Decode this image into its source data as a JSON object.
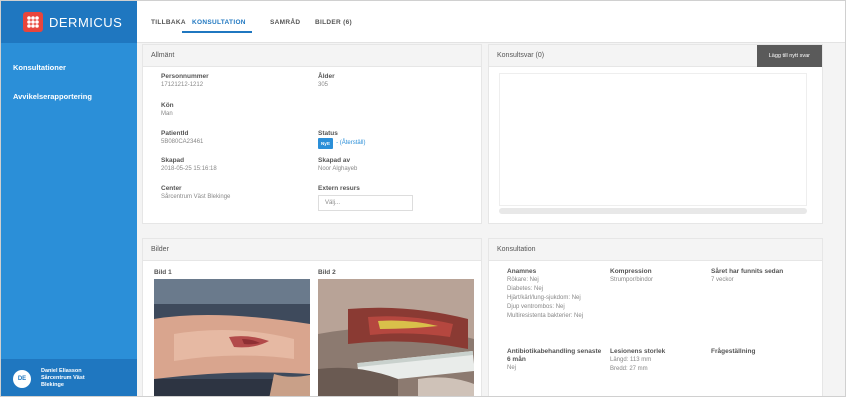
{
  "brand": {
    "name": "DERMICUS"
  },
  "sidebar": {
    "items": [
      {
        "label": "Konsultationer"
      },
      {
        "label": "Avvikelserapportering"
      }
    ]
  },
  "user": {
    "initials": "DE",
    "name": "Daniel Eliasson",
    "org_line1": "Sårcentrum Väst",
    "org_line2": "Blekinge"
  },
  "tabs": [
    {
      "label": "TILLBAKA"
    },
    {
      "label": "KONSULTATION",
      "active": true
    },
    {
      "label": "SAMRÅD"
    },
    {
      "label": "BILDER (6)"
    }
  ],
  "general": {
    "title": "Allmänt",
    "personnummer_label": "Personnummer",
    "personnummer": "17121212-1212",
    "alder_label": "Ålder",
    "alder": "305",
    "kon_label": "Kön",
    "kon": "Man",
    "patientid_label": "PatientId",
    "patientid": "5B080CA23461",
    "status_label": "Status",
    "status_badge": "Nytt",
    "status_link": "(Återställ)",
    "skapad_label": "Skapad",
    "skapad": "2018-05-25 15:16:18",
    "skapad_av_label": "Skapad av",
    "skapad_av": "Noor Alghayeb",
    "center_label": "Center",
    "center": "Sårcentrum Väst Blekinge",
    "extern_label": "Extern resurs",
    "extern_placeholder": "Välj..."
  },
  "answers": {
    "title": "Konsultsvar (0)",
    "add_button": "Lägg till nytt svar"
  },
  "images": {
    "title": "Bilder",
    "bild1": "Bild 1",
    "bild2": "Bild 2"
  },
  "consultation": {
    "title": "Konsultation",
    "anamnes_label": "Anamnes",
    "anamnes_lines": [
      "Rökare: Nej",
      "Diabetes: Nej",
      "Hjärt/kärl/lung-sjukdom: Nej",
      "Djup ventrombos: Nej",
      "Multiresistenta bakterier: Nej"
    ],
    "kompression_label": "Kompression",
    "kompression": "Strumpor/bindor",
    "saret_label": "Såret har funnits sedan",
    "saret": "7 veckor",
    "antibiotika_label_1": "Antibiotikabehandling senaste",
    "antibiotika_label_2": "6 mån",
    "antibiotika": "Nej",
    "lesion_label": "Lesionens storlek",
    "lesion_length": "Längd: 113 mm",
    "lesion_width": "Bredd: 27 mm",
    "fraga_label": "Frågeställning"
  },
  "colors": {
    "sidebar": "#2b8fd8",
    "sidebar_dark": "#1f77c0",
    "logo": "#e8453c",
    "active_tab": "#1f77c0",
    "button_dark": "#5a5a5a"
  }
}
